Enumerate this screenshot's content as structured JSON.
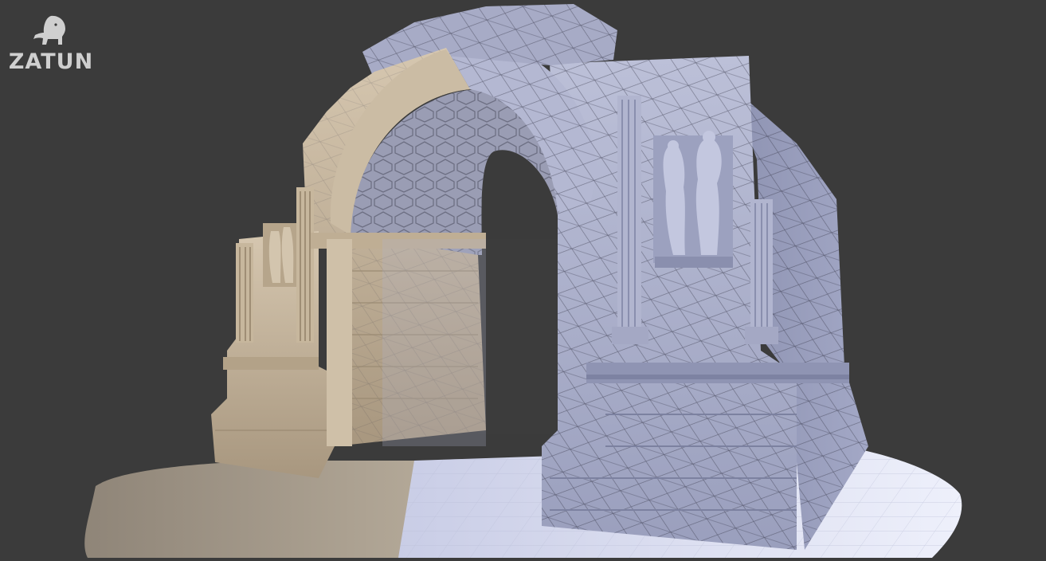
{
  "brand": {
    "logo_text": "ZATUN",
    "logo_icon": "lion-icon"
  },
  "scene": {
    "subject_icon": "triumphal-arch-3d-model",
    "colors": {
      "background": "#3b3b3b",
      "textured_stone": "#c9b8a0",
      "clay_render": "#a9aec9",
      "wireframe": "#2a2a3a",
      "ground_textured": "#9c9183",
      "ground_clay": "#d9dcef"
    }
  }
}
